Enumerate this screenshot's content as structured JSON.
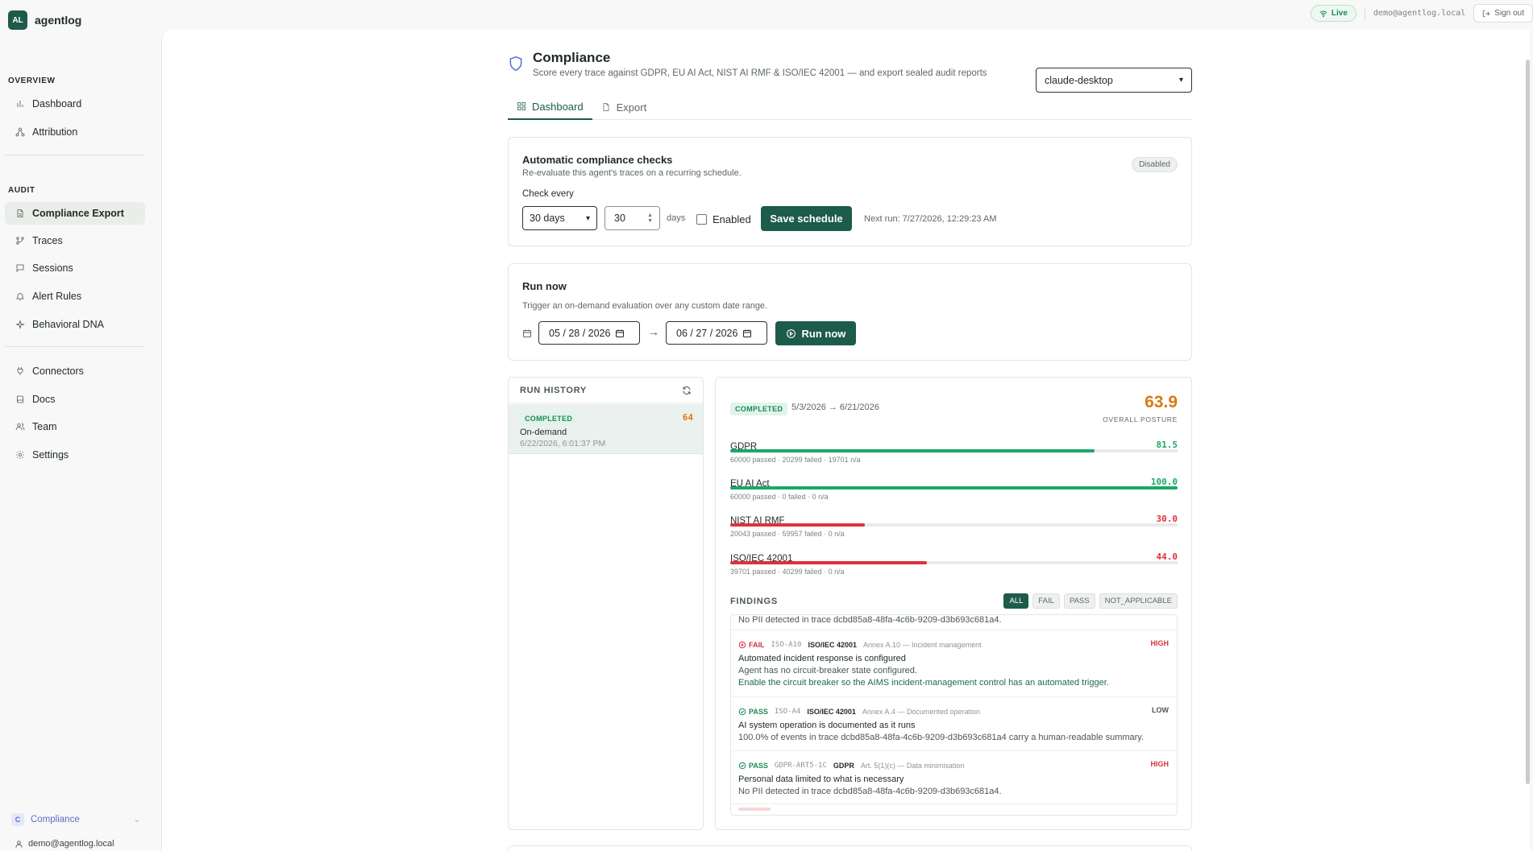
{
  "app": {
    "logo_initials": "AL",
    "name": "agentlog",
    "live_label": "Live",
    "user_email": "demo@agentlog.local",
    "sign_out_label": "Sign out"
  },
  "sidebar": {
    "overview_label": "OVERVIEW",
    "overview_items": [
      {
        "label": "Dashboard",
        "icon": "bar-chart-icon"
      },
      {
        "label": "Attribution",
        "icon": "network-icon"
      }
    ],
    "audit_label": "AUDIT",
    "audit_items": [
      {
        "label": "Compliance Export",
        "icon": "document-icon",
        "active": true
      },
      {
        "label": "Traces",
        "icon": "git-branch-icon"
      },
      {
        "label": "Sessions",
        "icon": "chat-icon"
      },
      {
        "label": "Alert Rules",
        "icon": "bell-icon"
      },
      {
        "label": "Behavioral DNA",
        "icon": "sparkle-icon"
      }
    ],
    "other_items": [
      {
        "label": "Connectors",
        "icon": "plug-icon"
      },
      {
        "label": "Docs",
        "icon": "book-icon"
      },
      {
        "label": "Team",
        "icon": "users-icon"
      },
      {
        "label": "Settings",
        "icon": "gear-icon"
      }
    ],
    "org": {
      "initial": "C",
      "name": "Compliance"
    },
    "user_email": "demo@agentlog.local"
  },
  "page": {
    "title": "Compliance",
    "subtitle": "Score every trace against GDPR, EU AI Act, NIST AI RMF & ISO/IEC 42001 — and export sealed audit reports",
    "agent_selected": "claude-desktop",
    "tabs": [
      {
        "label": "Dashboard",
        "active": true
      },
      {
        "label": "Export",
        "active": false
      }
    ]
  },
  "schedule": {
    "title": "Automatic compliance checks",
    "subtitle": "Re-evaluate this agent's traces on a recurring schedule.",
    "status": "Disabled",
    "check_every_label": "Check every",
    "interval_selected": "30 days",
    "interval_value": "30",
    "unit_label": "days",
    "enabled_label": "Enabled",
    "enabled": false,
    "save_label": "Save schedule",
    "next_run": "Next run: 7/27/2026, 12:29:23 AM"
  },
  "run_now": {
    "title": "Run now",
    "subtitle": "Trigger an on-demand evaluation over any custom date range.",
    "start_date": "05 / 28 / 2026",
    "end_date": "06 / 27 / 2026",
    "arrow": "→",
    "button_label": "Run now"
  },
  "history": {
    "title": "RUN HISTORY",
    "items": [
      {
        "status": "COMPLETED",
        "score": "64",
        "kind": "On-demand",
        "time": "6/22/2026, 6:01:37 PM"
      }
    ]
  },
  "detail": {
    "status": "COMPLETED",
    "range": "5/3/2026 → 6/21/2026",
    "overall_score": "63.9",
    "overall_label": "OVERALL POSTURE",
    "frameworks": [
      {
        "name": "GDPR",
        "score": "81.5",
        "pct": 81.5,
        "stats": "60000 passed · 20299 failed · 19701 n/a",
        "color": "#1aa866"
      },
      {
        "name": "EU AI Act",
        "score": "100.0",
        "pct": 100,
        "stats": "60000 passed · 0 failed · 0 n/a",
        "color": "#1aa866"
      },
      {
        "name": "NIST AI RMF",
        "score": "30.0",
        "pct": 30,
        "stats": "20043 passed · 59957 failed · 0 n/a",
        "color": "#e0303d"
      },
      {
        "name": "ISO/IEC 42001",
        "score": "44.0",
        "pct": 44,
        "stats": "39701 passed · 40299 failed · 0 n/a",
        "color": "#e0303d"
      }
    ],
    "findings_label": "FINDINGS",
    "filters": [
      "ALL",
      "FAIL",
      "PASS",
      "NOT_APPLICABLE"
    ],
    "active_filter": "ALL",
    "top_cut_text": "No PII detected in trace dcbd85a8-48fa-4c6b-9209-d3b693c681a4.",
    "findings": [
      {
        "result": "FAIL",
        "code": "ISO-A10",
        "framework": "ISO/IEC 42001",
        "clause": "Annex A.10 — Incident management",
        "severity": "HIGH",
        "title": "Automated incident response is configured",
        "desc": "Agent has no circuit-breaker state configured.",
        "remediation": "Enable the circuit breaker so the AIMS incident-management control has an automated trigger."
      },
      {
        "result": "PASS",
        "code": "ISO-A4",
        "framework": "ISO/IEC 42001",
        "clause": "Annex A.4 — Documented operation",
        "severity": "LOW",
        "title": "AI system operation is documented as it runs",
        "desc": "100.0% of events in trace dcbd85a8-48fa-4c6b-9209-d3b693c681a4 carry a human-readable summary.",
        "remediation": ""
      },
      {
        "result": "PASS",
        "code": "GDPR-ART5-1C",
        "framework": "GDPR",
        "clause": "Art. 5(1)(c) — Data minimisation",
        "severity": "HIGH",
        "title": "Personal data limited to what is necessary",
        "desc": "No PII detected in trace dcbd85a8-48fa-4c6b-9209-d3b693c681a4.",
        "remediation": ""
      }
    ]
  },
  "colors": {
    "accent": "#1d5b4a",
    "pass": "#1aa866",
    "fail": "#e0303d",
    "overall_score": "#d97a16",
    "history_score": "#d97a16"
  }
}
